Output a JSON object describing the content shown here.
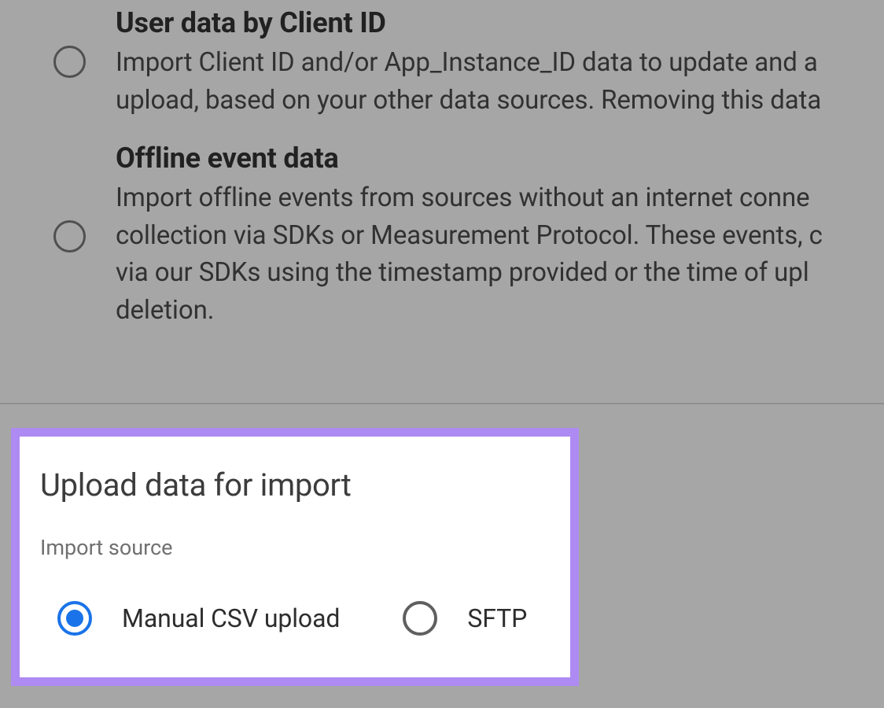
{
  "dataTypes": [
    {
      "title": "User data by Client ID",
      "descLine1": "Import Client ID and/or App_Instance_ID data to update and a",
      "descLine2": "upload, based on your other data sources. Removing this data"
    },
    {
      "title": "Offline event data",
      "descLine1": "Import offline events from sources without an internet conne",
      "descLine2": "collection via SDKs or Measurement Protocol. These events, c",
      "descLine3": "via our SDKs using the timestamp provided or the time of upl",
      "descLine4": "deletion."
    }
  ],
  "uploadCard": {
    "title": "Upload data for import",
    "subtitle": "Import source",
    "options": {
      "manual": "Manual CSV upload",
      "sftp": "SFTP"
    }
  }
}
